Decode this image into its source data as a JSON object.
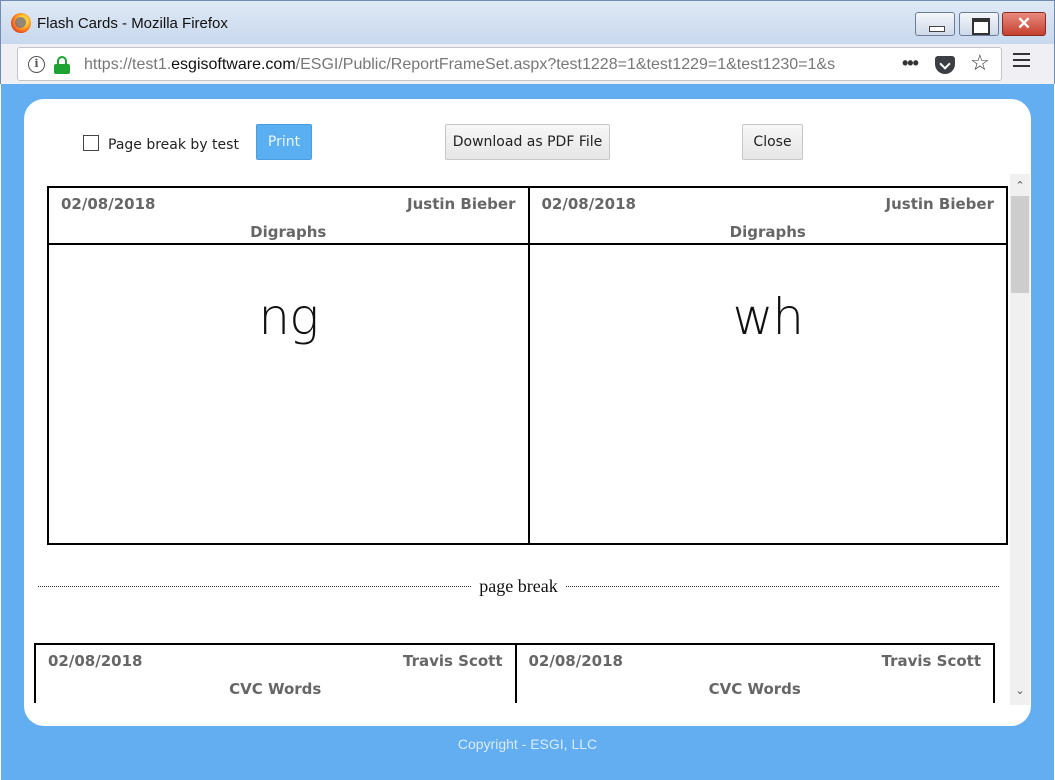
{
  "window": {
    "title": "Flash Cards - Mozilla Firefox",
    "close_glyph": "✕"
  },
  "browser": {
    "url_prefix": "https://test1.",
    "url_host": "esgisoftware.com",
    "url_rest": "/ESGI/Public/ReportFrameSet.aspx?test1228=1&test1229=1&test1230=1&s",
    "icons": [
      "info-icon",
      "lock-icon",
      "more-dots-icon",
      "pocket-icon",
      "star-icon",
      "hamburger-menu-icon"
    ],
    "more_glyph": "•••",
    "star_glyph": "☆"
  },
  "toolbar": {
    "page_break_label": "Page break by test",
    "page_break_checked": false,
    "print_label": "Print",
    "pdf_label": "Download as PDF File",
    "close_label": "Close"
  },
  "page1": {
    "cards": [
      {
        "date": "02/08/2018",
        "student": "Justin Bieber",
        "test": "Digraphs",
        "word": "ng"
      },
      {
        "date": "02/08/2018",
        "student": "Justin Bieber",
        "test": "Digraphs",
        "word": "wh"
      }
    ]
  },
  "page_break_label": "page break",
  "page2": {
    "cards": [
      {
        "date": "02/08/2018",
        "student": "Travis Scott",
        "test": "CVC Words"
      },
      {
        "date": "02/08/2018",
        "student": "Travis Scott",
        "test": "CVC Words"
      }
    ]
  },
  "scrollbar": {
    "up_glyph": "⌃",
    "down_glyph": "⌄"
  },
  "footer": {
    "copyright": "Copyright - ESGI, LLC"
  },
  "colors": {
    "page_background": "#63aef0",
    "print_button": "#5aaef2",
    "lock_green": "#1ea232"
  }
}
